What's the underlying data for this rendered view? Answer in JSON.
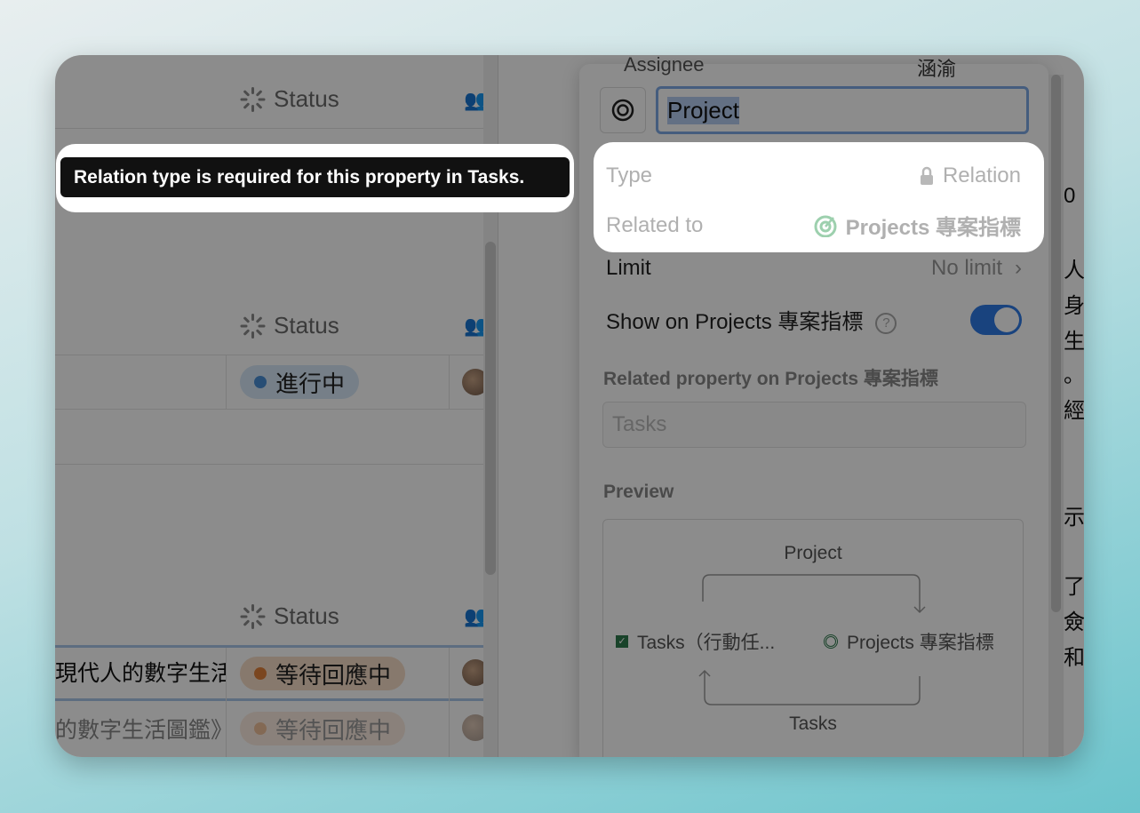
{
  "table": {
    "status_header": "Status",
    "rows": [
      {
        "title": "",
        "status": "進行中",
        "status_color": "#4a8fd6"
      },
      {
        "title": "現代人的數字生活",
        "status": "等待回應中",
        "status_color": "#e0803a"
      },
      {
        "title": "的數字生活圖鑑》",
        "status": "等待回應中",
        "status_color": "#e0803a"
      }
    ]
  },
  "tooltip": {
    "text": "Relation type is required for this property in Tasks."
  },
  "popup": {
    "behind_header": {
      "label": "Assignee",
      "value": "涵渝"
    },
    "icon": "target-icon",
    "name_value": "Project",
    "type_label": "Type",
    "type_value": "Relation",
    "related_label": "Related to",
    "related_value": "Projects 專案指標",
    "limit_label": "Limit",
    "limit_value": "No limit",
    "show_on_label": "Show on Projects 專案指標",
    "show_on_enabled": true,
    "related_property_label": "Related property on Projects 專案指標",
    "related_property_placeholder": "Tasks",
    "preview_label": "Preview",
    "preview": {
      "top_label": "Project",
      "left_db": "Tasks（行動任...",
      "right_db": "Projects 專案指標",
      "bottom_label": "Tasks"
    }
  },
  "side_text": [
    "0",
    "人",
    "身",
    "生",
    "。",
    "經",
    "示",
    "了",
    "僉",
    "和"
  ],
  "colors": {
    "accent": "#2f7ae5",
    "highlight": "#ffffff"
  }
}
